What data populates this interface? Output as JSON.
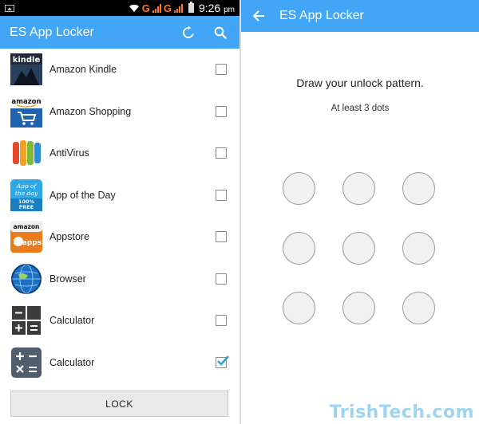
{
  "statusbar": {
    "network_1": "G",
    "network_2": "G",
    "time": "9:26",
    "time_suffix": "pm"
  },
  "left": {
    "title": "ES App Locker",
    "apps": [
      {
        "label": "Amazon Kindle",
        "checked": false,
        "icon": "kindle-icon"
      },
      {
        "label": "Amazon Shopping",
        "checked": false,
        "icon": "amazon-shopping-icon"
      },
      {
        "label": "AntiVirus",
        "checked": false,
        "icon": "antivirus-icon"
      },
      {
        "label": "App of the Day",
        "checked": false,
        "icon": "app-of-the-day-icon"
      },
      {
        "label": "Appstore",
        "checked": false,
        "icon": "appstore-icon"
      },
      {
        "label": "Browser",
        "checked": false,
        "icon": "browser-icon"
      },
      {
        "label": "Calculator",
        "checked": false,
        "icon": "calculator-icon"
      },
      {
        "label": "Calculator",
        "checked": true,
        "icon": "calculator-blue-icon"
      }
    ],
    "lock_label": "LOCK"
  },
  "right": {
    "title": "ES App Locker",
    "prompt": "Draw your unlock pattern.",
    "hint": "At least 3 dots"
  },
  "icon_text": {
    "kindle": "kindle",
    "amazon": "amazon",
    "aotd_1": "App of",
    "aotd_2": "the day",
    "aotd_3": "100%",
    "aotd_4": "FREE",
    "appstore_top": "amazon",
    "appstore_bottom": "apps"
  },
  "watermark": "TrishTech.com",
  "colors": {
    "accent": "#42a5f5",
    "check": "#29a3e0"
  }
}
